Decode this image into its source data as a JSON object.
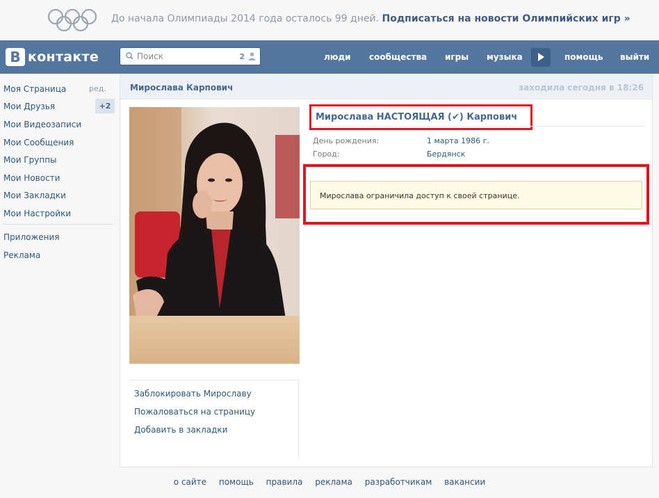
{
  "banner": {
    "text": "До начала Олимпиады 2014 года осталось 99 дней.",
    "link": "Подписаться на новости Олимпийских игр »"
  },
  "header": {
    "logo_letter": "В",
    "logo_text": "контакте",
    "search": {
      "placeholder": "Поиск",
      "count": "2"
    },
    "nav": [
      "люди",
      "сообщества",
      "игры",
      "музыка",
      "помощь",
      "выйти"
    ]
  },
  "sidebar": {
    "items": [
      {
        "label": "Моя Страница",
        "edit": "ред."
      },
      {
        "label": "Мои Друзья",
        "badge": "+2"
      },
      {
        "label": "Мои Видеозаписи"
      },
      {
        "label": "Мои Сообщения"
      },
      {
        "label": "Мои Группы"
      },
      {
        "label": "Мои Новости"
      },
      {
        "label": "Мои Закладки"
      },
      {
        "label": "Мои Настройки"
      }
    ],
    "extra": [
      {
        "label": "Приложения"
      },
      {
        "label": "Реклама"
      }
    ]
  },
  "profile": {
    "header_name": "Мирослава Карпович",
    "last_seen": "заходила сегодня в 18:26",
    "full_name": "Мирослава НАСТОЯЩАЯ (✔) Карпович",
    "birthday_label": "День рождения:",
    "birthday_value": "1 марта 1986 г.",
    "city_label": "Город:",
    "city_value": "Бердянск",
    "restriction_text": "Мирослава ограничила доступ к своей странице.",
    "actions": [
      "Заблокировать Мирославу",
      "Пожаловаться на страницу",
      "Добавить в закладки"
    ]
  },
  "footer": {
    "links": [
      "о сайте",
      "помощь",
      "правила",
      "реклама",
      "разработчикам",
      "вакансии"
    ]
  },
  "colors": {
    "header_bg": "#55779f",
    "link": "#2b587a",
    "highlight_red": "#e3141c",
    "notice_bg": "#fefbe4"
  }
}
